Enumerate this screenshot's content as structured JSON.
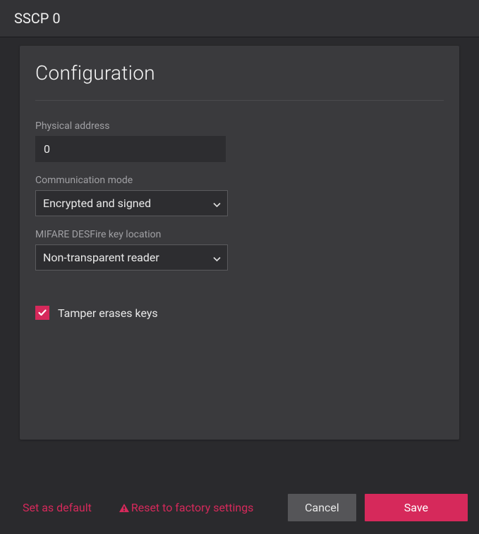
{
  "header": {
    "title": "SSCP 0"
  },
  "panel": {
    "title": "Configuration"
  },
  "fields": {
    "physical_address": {
      "label": "Physical address",
      "value": "0"
    },
    "communication_mode": {
      "label": "Communication mode",
      "value": "Encrypted and signed"
    },
    "key_location": {
      "label": "MIFARE DESFire key location",
      "value": "Non-transparent reader"
    },
    "tamper": {
      "label": "Tamper erases keys",
      "checked": true
    }
  },
  "footer": {
    "set_default": "Set as default",
    "reset": "Reset to factory settings",
    "cancel": "Cancel",
    "save": "Save"
  },
  "colors": {
    "accent": "#d6295b"
  }
}
